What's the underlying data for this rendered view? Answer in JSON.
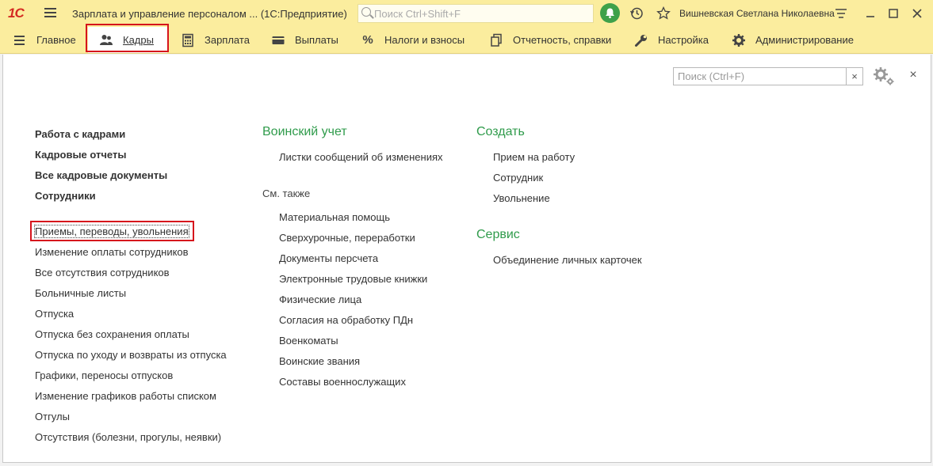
{
  "app": {
    "logo": "1С",
    "title": "Зарплата и управление персоналом ... (1С:Предприятие)",
    "search_placeholder": "Поиск Ctrl+Shift+F",
    "user": "Вишневская Светлана Николаевна"
  },
  "sections": [
    {
      "label": "Главное",
      "icon": "menu-icon"
    },
    {
      "label": "Кадры",
      "icon": "people-icon"
    },
    {
      "label": "Зарплата",
      "icon": "calculator-icon"
    },
    {
      "label": "Выплаты",
      "icon": "wallet-icon"
    },
    {
      "label": "Налоги и взносы",
      "icon": "percent-icon"
    },
    {
      "label": "Отчетность, справки",
      "icon": "documents-icon"
    },
    {
      "label": "Настройка",
      "icon": "wrench-icon"
    },
    {
      "label": "Администрирование",
      "icon": "gear-icon"
    }
  ],
  "panel": {
    "search_placeholder": "Поиск (Ctrl+F)",
    "search_clear": "×",
    "close": "×"
  },
  "col1": {
    "bold_links": [
      "Работа с кадрами",
      "Кадровые отчеты",
      "Все кадровые документы",
      "Сотрудники"
    ],
    "links": [
      "Приемы, переводы, увольнения",
      "Изменение оплаты сотрудников",
      "Все отсутствия сотрудников",
      "Больничные листы",
      "Отпуска",
      "Отпуска без сохранения оплаты",
      "Отпуска по уходу и возвраты из отпуска",
      "Графики, переносы отпусков",
      "Изменение графиков работы списком",
      "Отгулы",
      "Отсутствия (болезни, прогулы, неявки)"
    ]
  },
  "col2": {
    "title": "Воинский учет",
    "links": [
      "Листки сообщений об изменениях"
    ],
    "see_also_title": "См. также",
    "see_also": [
      "Материальная помощь",
      "Сверхурочные, переработки",
      "Документы персчета",
      "Электронные трудовые книжки",
      "Физические лица",
      "Согласия на обработку ПДн",
      "Военкоматы",
      "Воинские звания",
      "Составы военнослужащих"
    ]
  },
  "col3": {
    "create_title": "Создать",
    "create_links": [
      "Прием на работу",
      "Сотрудник",
      "Увольнение"
    ],
    "service_title": "Сервис",
    "service_links": [
      "Объединение личных карточек"
    ]
  },
  "colors": {
    "bar": "#fbed9e",
    "group_title": "#2f9b4b",
    "highlight": "#d6141c"
  }
}
